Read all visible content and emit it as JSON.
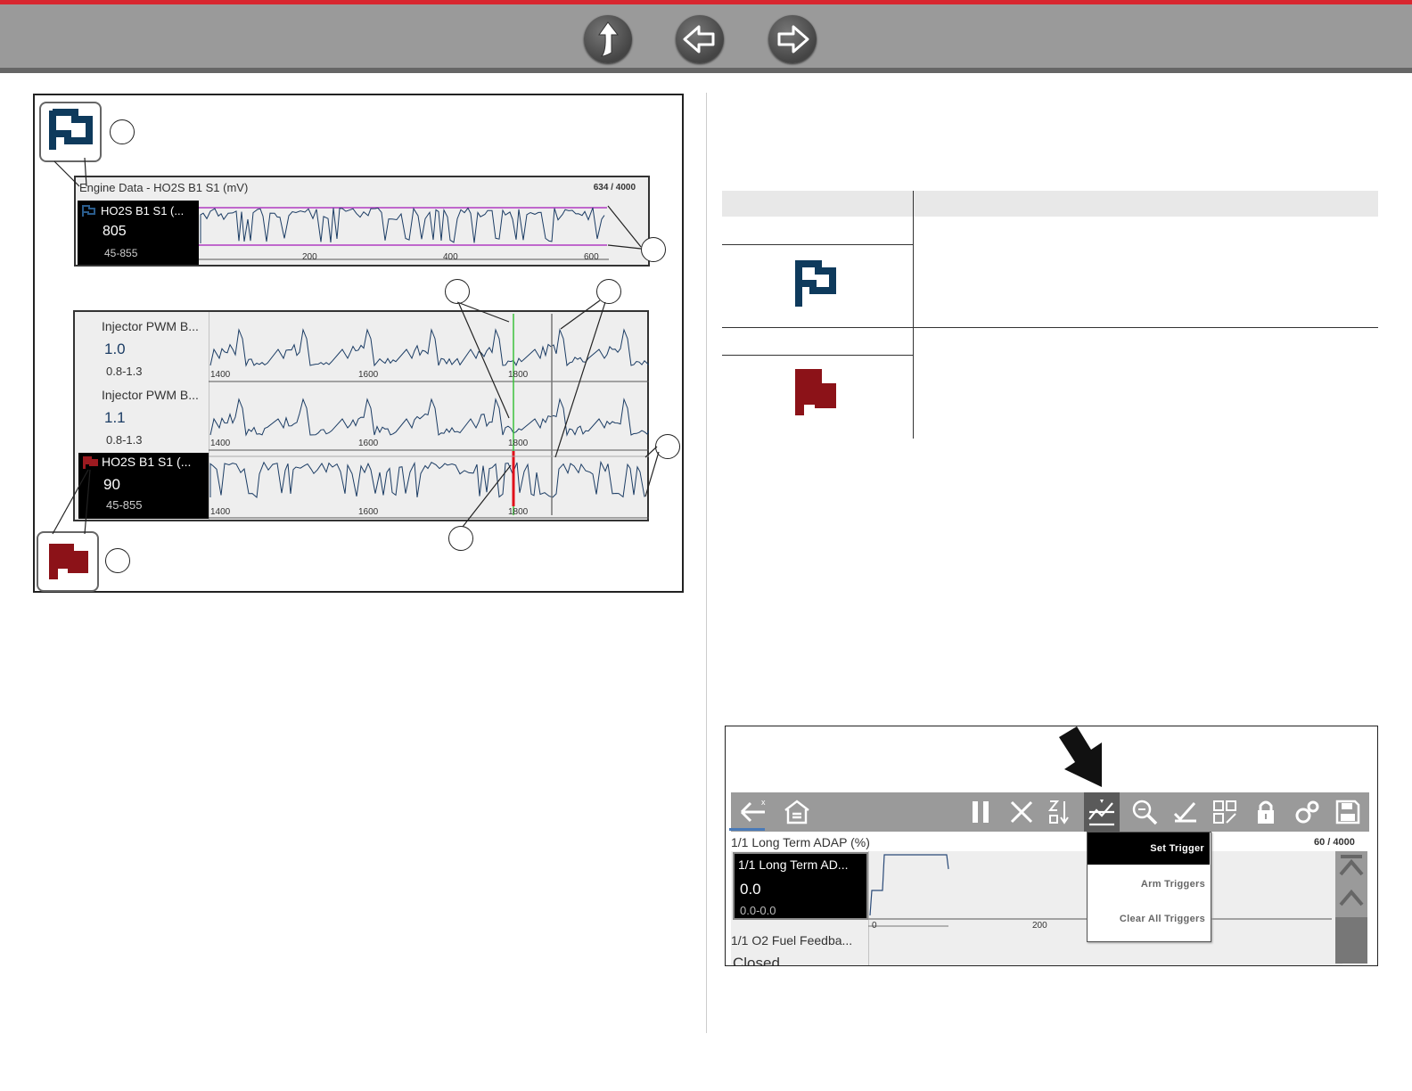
{
  "nav": {
    "buttons": [
      {
        "name": "up-arrow-icon"
      },
      {
        "name": "left-arrow-icon"
      },
      {
        "name": "right-arrow-icon"
      }
    ]
  },
  "figure1": {
    "top_graph": {
      "title": "Engine Data - HO2S B1 S1 (mV)",
      "counter": "634 / 4000",
      "param_name": "HO2S B1 S1 (...",
      "value": "805",
      "range": "45-855",
      "ticks": [
        "200",
        "400",
        "600"
      ]
    },
    "graph_rows": [
      {
        "param_name": "Injector PWM B...",
        "value": "1.0",
        "range": "0.8-1.3",
        "ticks": [
          "1400",
          "1600",
          "1800"
        ]
      },
      {
        "param_name": "Injector PWM B...",
        "value": "1.1",
        "range": "0.8-1.3",
        "ticks": [
          "1400",
          "1600",
          "1800"
        ]
      },
      {
        "param_name": "HO2S B1 S1 (...",
        "value": "90",
        "range": "45-855",
        "ticks": [
          "1400",
          "1600",
          "1800"
        ]
      }
    ],
    "colors": {
      "blue_flag": "#0e3a5c",
      "red_flag": "#8c1218",
      "threshold_line": "#b03cc0",
      "green_cursor": "#3cc13c",
      "red_cursor": "#e0101a"
    }
  },
  "figure2": {
    "param_title": "1/1 Long Term ADAP (%)",
    "counter": "60 / 4000",
    "row1": {
      "param_name": "1/1 Long Term AD...",
      "value": "0.0",
      "range": "0.0-0.0"
    },
    "row2": {
      "param_name": "1/1 O2 Fuel Feedba...",
      "value": "Closed"
    },
    "ticks": [
      "0",
      "200"
    ],
    "menu": {
      "set_trigger": "Set Trigger",
      "arm_triggers": "Arm Triggers",
      "clear_all_triggers": "Clear All Triggers"
    }
  }
}
